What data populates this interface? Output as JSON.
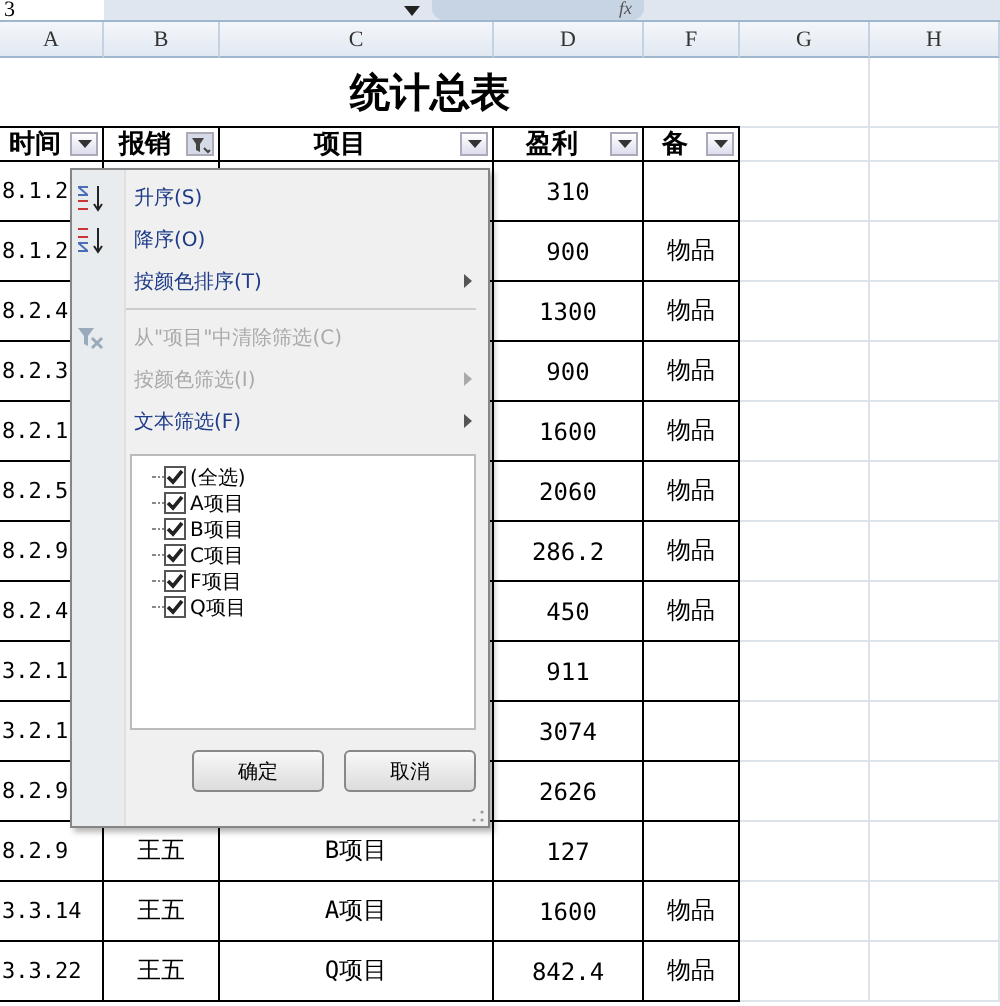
{
  "formula_bar": {
    "name_box": "3",
    "fx": "fx"
  },
  "columns": [
    "A",
    "B",
    "C",
    "D",
    "F",
    "G",
    "H"
  ],
  "title": "统计总表",
  "headers": [
    {
      "label": "时间",
      "filter": false
    },
    {
      "label": "报销",
      "filter": true
    },
    {
      "label": "项目",
      "filter": false
    },
    {
      "label": "盈利",
      "filter": false
    },
    {
      "label": "备",
      "filter": false
    }
  ],
  "rows": [
    {
      "a": "8.1.2",
      "d": "310"
    },
    {
      "a": "8.1.2",
      "d": "900",
      "f": "物品"
    },
    {
      "a": "8.2.4",
      "d": "1300",
      "f": "物品"
    },
    {
      "a": "8.2.3",
      "d": "900",
      "f": "物品"
    },
    {
      "a": "8.2.1",
      "d": "1600",
      "f": "物品"
    },
    {
      "a": "8.2.5",
      "d": "2060",
      "f": "物品"
    },
    {
      "a": "8.2.9",
      "d": "286.2",
      "f": "物品"
    },
    {
      "a": "8.2.4",
      "d": "450",
      "f": "物品"
    },
    {
      "a": "3.2.1",
      "d": "911"
    },
    {
      "a": "3.2.1",
      "d": "3074"
    },
    {
      "a": "8.2.9",
      "d": "2626"
    },
    {
      "a": "8.2.9",
      "b": "王五",
      "c": "B项目",
      "d": "127"
    },
    {
      "a": "3.3.14",
      "b": "王五",
      "c": "A项目",
      "d": "1600",
      "f": "物品"
    },
    {
      "a": "3.3.22",
      "b": "王五",
      "c": "Q项目",
      "d": "842.4",
      "f": "物品"
    }
  ],
  "menu": {
    "items": [
      {
        "kind": "sort-asc",
        "label": "升序(S)",
        "disabled": false,
        "submenu": false
      },
      {
        "kind": "sort-desc",
        "label": "降序(O)",
        "disabled": false,
        "submenu": false
      },
      {
        "kind": "plain",
        "label": "按颜色排序(T)",
        "disabled": false,
        "submenu": true
      },
      {
        "kind": "separator"
      },
      {
        "kind": "clear",
        "label": "从\"项目\"中清除筛选(C)",
        "disabled": true,
        "submenu": false
      },
      {
        "kind": "plain",
        "label": "按颜色筛选(I)",
        "disabled": true,
        "submenu": true
      },
      {
        "kind": "plain",
        "label": "文本筛选(F)",
        "disabled": false,
        "submenu": true
      }
    ],
    "values": [
      {
        "label": "(全选)",
        "checked": true
      },
      {
        "label": "A项目",
        "checked": true
      },
      {
        "label": "B项目",
        "checked": true
      },
      {
        "label": "C项目",
        "checked": true
      },
      {
        "label": "F项目",
        "checked": true
      },
      {
        "label": "Q项目",
        "checked": true
      }
    ],
    "buttons": [
      "确定",
      "取消"
    ]
  }
}
